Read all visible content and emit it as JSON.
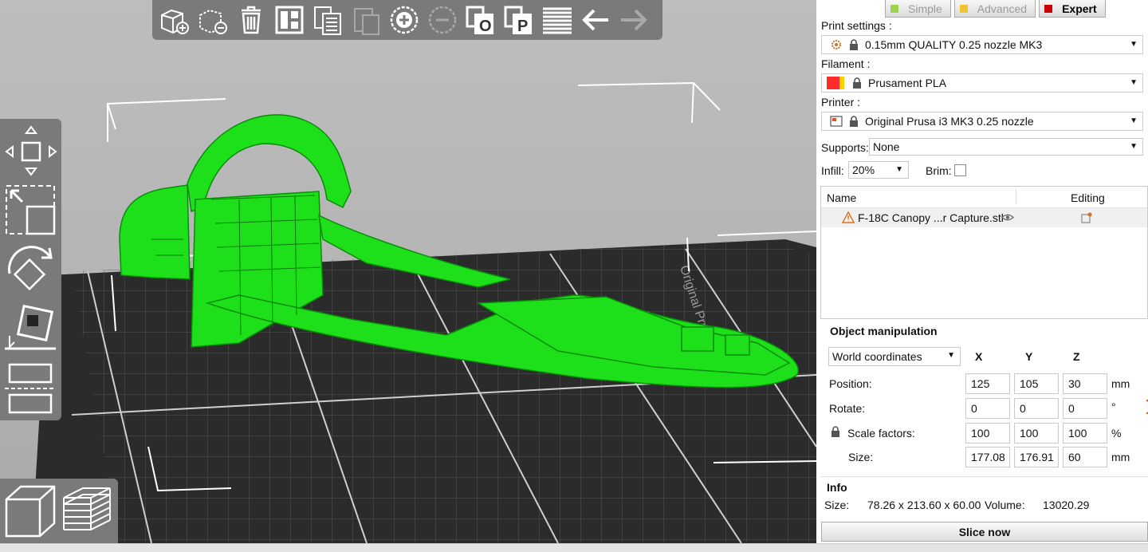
{
  "modes": [
    {
      "label": "Simple",
      "color": "#9bd54a"
    },
    {
      "label": "Advanced",
      "color": "#f1c232"
    },
    {
      "label": "Expert",
      "color": "#cc0000"
    }
  ],
  "print_settings": {
    "label": "Print settings :",
    "value": "0.15mm QUALITY 0.25 nozzle MK3",
    "icon": "gear-icon"
  },
  "filament": {
    "label": "Filament :",
    "value": "Prusament PLA",
    "swatch_colors": [
      "#ff2a2a",
      "#f5d400"
    ]
  },
  "printer": {
    "label": "Printer :",
    "value": "Original Prusa i3 MK3 0.25 nozzle",
    "icon": "printer-icon"
  },
  "supports": {
    "label": "Supports:",
    "value": "None"
  },
  "infill": {
    "label": "Infill:",
    "value": "20%"
  },
  "brim": {
    "label": "Brim:",
    "checked": false
  },
  "object_list": {
    "headers": {
      "name": "Name",
      "editing": "Editing"
    },
    "items": [
      {
        "name": "F-18C Canopy ...r Capture.stl",
        "warning": true,
        "visible": true
      }
    ]
  },
  "object_manipulation": {
    "title": "Object manipulation",
    "coordinates": "World coordinates",
    "axes": [
      "X",
      "Y",
      "Z"
    ],
    "rows": [
      {
        "label": "Position:",
        "values": [
          "125",
          "105",
          "30"
        ],
        "unit": "mm"
      },
      {
        "label": "Rotate:",
        "values": [
          "0",
          "0",
          "0"
        ],
        "unit": "°"
      },
      {
        "label": "Scale factors:",
        "values": [
          "100",
          "100",
          "100"
        ],
        "unit": "%"
      },
      {
        "label": "Size:",
        "values": [
          "177.08",
          "176.91",
          "60"
        ],
        "unit": "mm"
      }
    ]
  },
  "info": {
    "title": "Info",
    "size_label": "Size:",
    "size_value": "78.26 x 213.60 x 60.00",
    "volume_label": "Volume:",
    "volume_value": "13020.29"
  },
  "slice_button": "Slice now",
  "bed_label": "Original Prusa i3 MK3",
  "colors": {
    "model": "#1ee01a",
    "bed": "#2f2f2f",
    "toolbar": "#7a7a7a",
    "accent": "#e06a1a"
  },
  "toolbar_icons": [
    "add-object-icon",
    "delete-object-icon",
    "delete-all-icon",
    "arrange-icon",
    "copy-icon",
    "paste-icon",
    "add-instance-icon",
    "remove-instance-icon",
    "split-objects-icon",
    "split-parts-icon",
    "layers-editing-icon",
    "undo-icon",
    "redo-icon"
  ]
}
